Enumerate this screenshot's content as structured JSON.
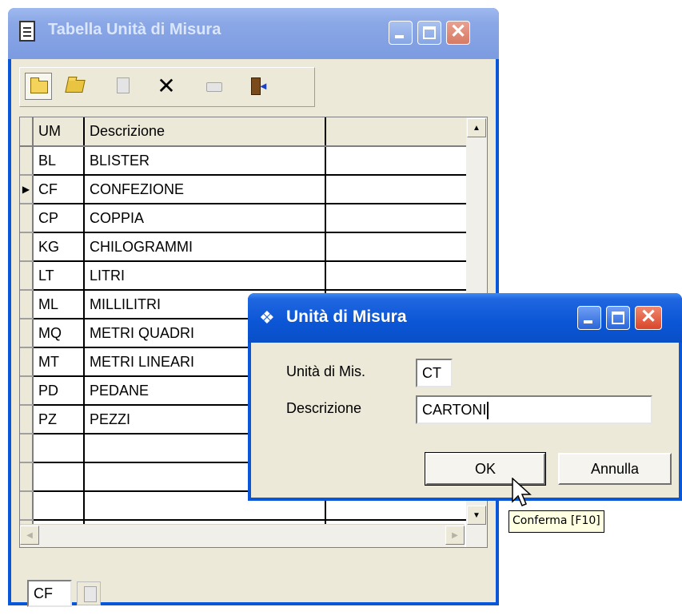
{
  "main_window": {
    "title": "Tabella Unità di Misura",
    "toolbar": [
      {
        "name": "new-button",
        "icon": "folder-icon",
        "enabled": true
      },
      {
        "name": "open-button",
        "icon": "open-folder-icon",
        "enabled": true
      },
      {
        "name": "preview-button",
        "icon": "preview-icon",
        "enabled": false
      },
      {
        "name": "delete-button",
        "icon": "delete-x-icon",
        "enabled": true
      },
      {
        "name": "print-button",
        "icon": "printer-icon",
        "enabled": false
      },
      {
        "name": "exit-button",
        "icon": "exit-door-icon",
        "enabled": true
      }
    ],
    "grid": {
      "columns": [
        "UM",
        "Descrizione",
        ""
      ],
      "rows": [
        {
          "um": "BL",
          "descr": "BLISTER"
        },
        {
          "um": "CF",
          "descr": "CONFEZIONE",
          "current": true
        },
        {
          "um": "CP",
          "descr": "COPPIA"
        },
        {
          "um": "KG",
          "descr": "CHILOGRAMMI"
        },
        {
          "um": "LT",
          "descr": "LITRI"
        },
        {
          "um": "ML",
          "descr": "MILLILITRI"
        },
        {
          "um": "MQ",
          "descr": "METRI QUADRI"
        },
        {
          "um": "MT",
          "descr": "METRI LINEARI"
        },
        {
          "um": "PD",
          "descr": "PEDANE"
        },
        {
          "um": "PZ",
          "descr": "PEZZI"
        },
        {
          "um": "",
          "descr": ""
        },
        {
          "um": "",
          "descr": ""
        },
        {
          "um": "",
          "descr": ""
        },
        {
          "um": "",
          "descr": ""
        }
      ]
    },
    "status_code": "CF"
  },
  "dialog": {
    "title": "Unità di Misura",
    "unit_label": "Unità di Mis.",
    "unit_value": "CT",
    "descr_label": "Descrizione",
    "descr_value": "CARTONI",
    "ok_label": "OK",
    "cancel_label": "Annulla"
  },
  "tooltip": "Conferma [F10]",
  "colors": {
    "titlebar": "#0a56d9",
    "face": "#ece9d8",
    "tooltip_bg": "#ffffe1"
  }
}
